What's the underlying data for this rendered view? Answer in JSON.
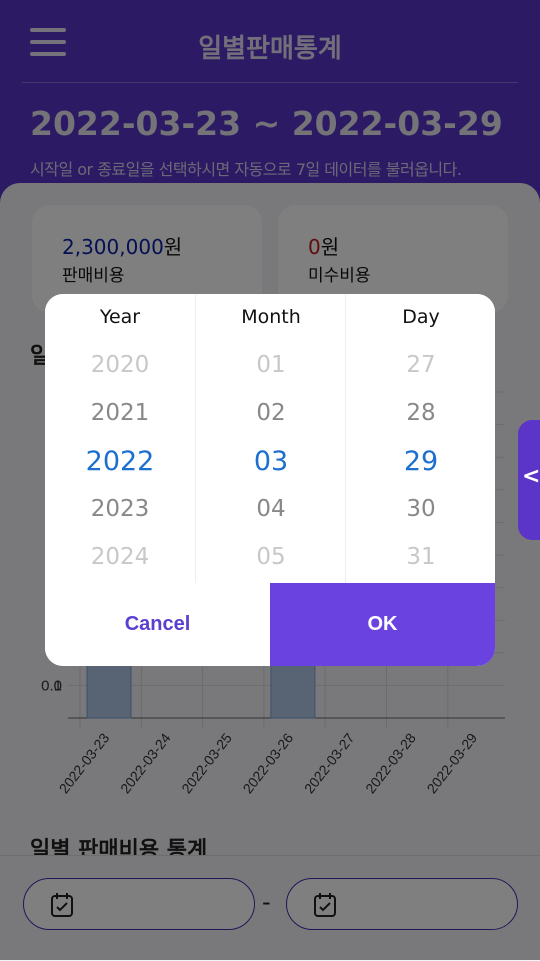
{
  "header": {
    "title": "일별판매통계"
  },
  "date_range": "2022-03-23 ~ 2022-03-29",
  "hint": "시작일 or 종료일을 선택하시면 자동으로 7일 데이터를 불러옵니다.",
  "cards": [
    {
      "amount_value": "2,300,000",
      "amount_unit": "원",
      "label": "판매비용"
    },
    {
      "amount_value": "0",
      "amount_unit": "원",
      "label": "미수비용"
    }
  ],
  "sections": {
    "chart_title_partial": "일",
    "bottom_title": "일별 판매비용 통계"
  },
  "chart_data": {
    "type": "bar",
    "categories": [
      "2022-03-23",
      "2022-03-24",
      "2022-03-25",
      "2022-03-26",
      "2022-03-27",
      "2022-03-28",
      "2022-03-29"
    ],
    "y_ticks_visible": [
      "0.1",
      "0"
    ],
    "ylim": [
      0,
      1
    ]
  },
  "picker": {
    "columns": [
      {
        "header": "Year",
        "options": [
          "2020",
          "2021",
          "2022",
          "2023",
          "2024"
        ],
        "selected": "2022"
      },
      {
        "header": "Month",
        "options": [
          "01",
          "02",
          "03",
          "04",
          "05"
        ],
        "selected": "03"
      },
      {
        "header": "Day",
        "options": [
          "27",
          "28",
          "29",
          "30",
          "31"
        ],
        "selected": "29"
      }
    ],
    "cancel_label": "Cancel",
    "ok_label": "OK"
  },
  "side_tab": {
    "icon": "chevron-left-icon",
    "glyph": "<"
  },
  "footer": {
    "separator": "-"
  },
  "colors": {
    "primary": "#5b34c8",
    "accent": "#6a42e0",
    "selected": "#1d6fcf"
  }
}
